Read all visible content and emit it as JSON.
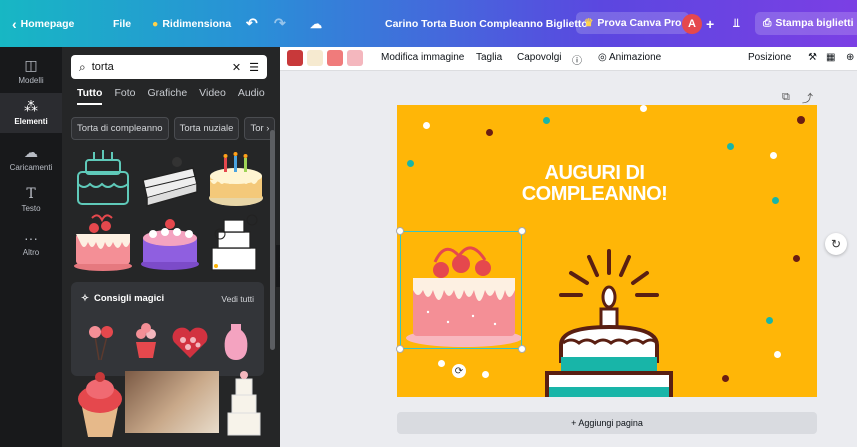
{
  "topbar": {
    "back_icon": "chevron-left-icon",
    "home_label": "Homepage",
    "file_label": "File",
    "resize_label": "Ridimensiona",
    "undo_icon": "undo-icon",
    "redo_icon": "redo-icon",
    "cloud_icon": "cloud-saved-icon",
    "doc_title": "Carino Torta Buon Compleanno Biglietto",
    "try_pro_label": "Prova Canva Pro",
    "avatar_initial": "A",
    "add_icon": "plus-icon",
    "stats_icon": "bar-chart-icon",
    "print_label": "Stampa biglietti"
  },
  "rail": {
    "items": [
      {
        "label": "Modelli",
        "icon": "template-icon"
      },
      {
        "label": "Elementi",
        "icon": "elements-icon"
      },
      {
        "label": "Caricamenti",
        "icon": "upload-icon"
      },
      {
        "label": "Testo",
        "icon": "text-icon"
      },
      {
        "label": "Altro",
        "icon": "more-icon"
      }
    ]
  },
  "panel": {
    "search_value": "torta",
    "tabs": [
      "Tutto",
      "Foto",
      "Grafiche",
      "Video",
      "Audio"
    ],
    "chips": [
      "Torta di compleanno",
      "Torta nuziale",
      "Tor"
    ],
    "magic_title": "Consigli magici",
    "magic_all": "Vedi tutti"
  },
  "toolbar": {
    "swatches": [
      "#c8393a",
      "#f6ead0",
      "#f07b7b",
      "#f4b7be"
    ],
    "edit_image": "Modifica immagine",
    "crop": "Taglia",
    "flip": "Capovolgi",
    "animate": "Animazione",
    "position": "Posizione"
  },
  "design": {
    "title_line1": "AUGURI DI",
    "title_line2": "COMPLEANNO!",
    "background": "#ffb607"
  },
  "canvas": {
    "add_page": "+ Aggiungi pagina"
  }
}
